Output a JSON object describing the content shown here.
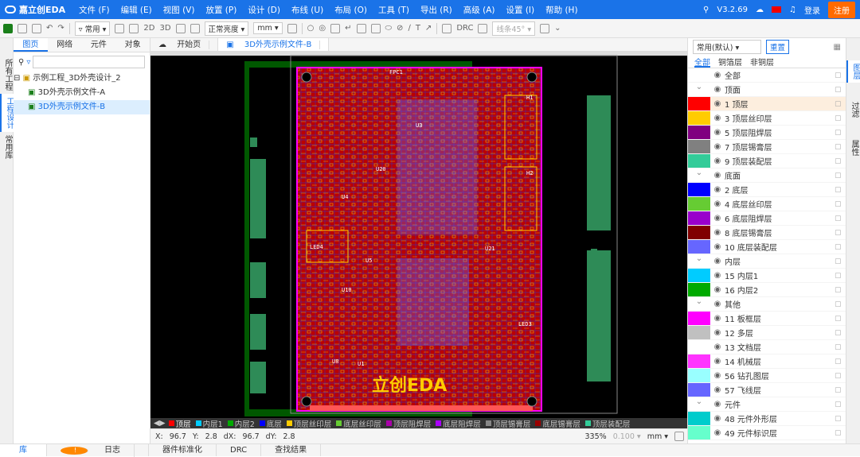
{
  "menubar": {
    "logo": "嘉立创EDA",
    "items": [
      "文件 (F)",
      "编辑 (E)",
      "视图 (V)",
      "放置 (P)",
      "设计 (D)",
      "布线 (U)",
      "布局 (O)",
      "工具 (T)",
      "导出 (R)",
      "高级 (A)",
      "设置 (I)",
      "帮助 (H)"
    ],
    "version": "V3.2.69",
    "login": "登录",
    "register": "注册"
  },
  "toolbar": {
    "mode": "常用",
    "view2d": "2D",
    "view3d": "3D",
    "brightness": "正常亮度",
    "unit": "mm",
    "drc": "DRC",
    "line_width": "线条45°"
  },
  "left_strip": [
    "所有工程",
    "工程设计",
    "常用库"
  ],
  "left_panel": {
    "tabs": [
      "图页",
      "网络",
      "元件",
      "对象"
    ],
    "project": "示例工程_3D外壳设计_2",
    "files": [
      "3D外壳示例文件-A",
      "3D外壳示例文件-B"
    ]
  },
  "doc_tabs": [
    "开始页",
    "3D外壳示例文件-B"
  ],
  "layer_bar": [
    {
      "name": "顶层",
      "color": "#ff0000"
    },
    {
      "name": "内层1",
      "color": "#00ccff"
    },
    {
      "name": "内层2",
      "color": "#00aa00"
    },
    {
      "name": "底层",
      "color": "#0000ff"
    },
    {
      "name": "顶层丝印层",
      "color": "#ffcc00"
    },
    {
      "name": "底层丝印层",
      "color": "#66cc33"
    },
    {
      "name": "顶层阻焊层",
      "color": "#aa00aa"
    },
    {
      "name": "底层阻焊层",
      "color": "#aa00ff"
    },
    {
      "name": "顶层锡膏层",
      "color": "#888888"
    },
    {
      "name": "底层锡膏层",
      "color": "#990000"
    },
    {
      "name": "顶层装配层",
      "color": "#33cc99"
    }
  ],
  "status": {
    "x_label": "X:",
    "x": "96.7",
    "y_label": "Y:",
    "y": "2.8",
    "dx_label": "dX:",
    "dx": "96.7",
    "dy_label": "dY:",
    "dy": "2.8",
    "zoom": "335%",
    "grid": "0.100",
    "unit": "mm"
  },
  "right_panel": {
    "preset": "常用(默认)",
    "reset": "重置",
    "tabs": [
      "全部",
      "铜箔层",
      "非铜层"
    ],
    "rows": [
      {
        "type": "all",
        "name": "全部"
      },
      {
        "type": "group",
        "name": "顶面"
      },
      {
        "type": "layer",
        "name": "1 顶层",
        "color": "#ff0000",
        "current": true
      },
      {
        "type": "layer",
        "name": "3 顶层丝印层",
        "color": "#ffcc00"
      },
      {
        "type": "layer",
        "name": "5 顶层阻焊层",
        "color": "#800080"
      },
      {
        "type": "layer",
        "name": "7 顶层锡膏层",
        "color": "#808080"
      },
      {
        "type": "layer",
        "name": "9 顶层装配层",
        "color": "#33cc99"
      },
      {
        "type": "group",
        "name": "底面"
      },
      {
        "type": "layer",
        "name": "2 底层",
        "color": "#0000ff"
      },
      {
        "type": "layer",
        "name": "4 底层丝印层",
        "color": "#66cc33"
      },
      {
        "type": "layer",
        "name": "6 底层阻焊层",
        "color": "#9900cc"
      },
      {
        "type": "layer",
        "name": "8 底层锡膏层",
        "color": "#800000"
      },
      {
        "type": "layer",
        "name": "10 底层装配层",
        "color": "#6666ff"
      },
      {
        "type": "group",
        "name": "内层"
      },
      {
        "type": "layer",
        "name": "15 内层1",
        "color": "#00ccff"
      },
      {
        "type": "layer",
        "name": "16 内层2",
        "color": "#00aa00"
      },
      {
        "type": "group",
        "name": "其他"
      },
      {
        "type": "layer",
        "name": "11 板框层",
        "color": "#ff00ff"
      },
      {
        "type": "layer",
        "name": "12 多层",
        "color": "#c0c0c0"
      },
      {
        "type": "layer",
        "name": "13 文档层",
        "color": "#ffffff"
      },
      {
        "type": "layer",
        "name": "14 机械层",
        "color": "#ff33ff"
      },
      {
        "type": "layer",
        "name": "56 钻孔图层",
        "color": "#99ffff"
      },
      {
        "type": "layer",
        "name": "57 飞线层",
        "color": "#6666ff"
      },
      {
        "type": "group",
        "name": "元件"
      },
      {
        "type": "layer",
        "name": "48 元件外形层",
        "color": "#00cccc"
      },
      {
        "type": "layer",
        "name": "49 元件标识层",
        "color": "#66ffcc"
      }
    ]
  },
  "right_strip": [
    "图层",
    "过滤",
    "属性"
  ],
  "bottom_tabs": [
    "库",
    "日志",
    "器件标准化",
    "DRC",
    "查找结果"
  ],
  "pcb": {
    "labels": [
      "FPC1",
      "U3",
      "U20",
      "U4",
      "H1",
      "H2",
      "LED4",
      "U5",
      "U21",
      "U1",
      "LED3",
      "U10",
      "U8"
    ],
    "logo": "立创EDA"
  }
}
